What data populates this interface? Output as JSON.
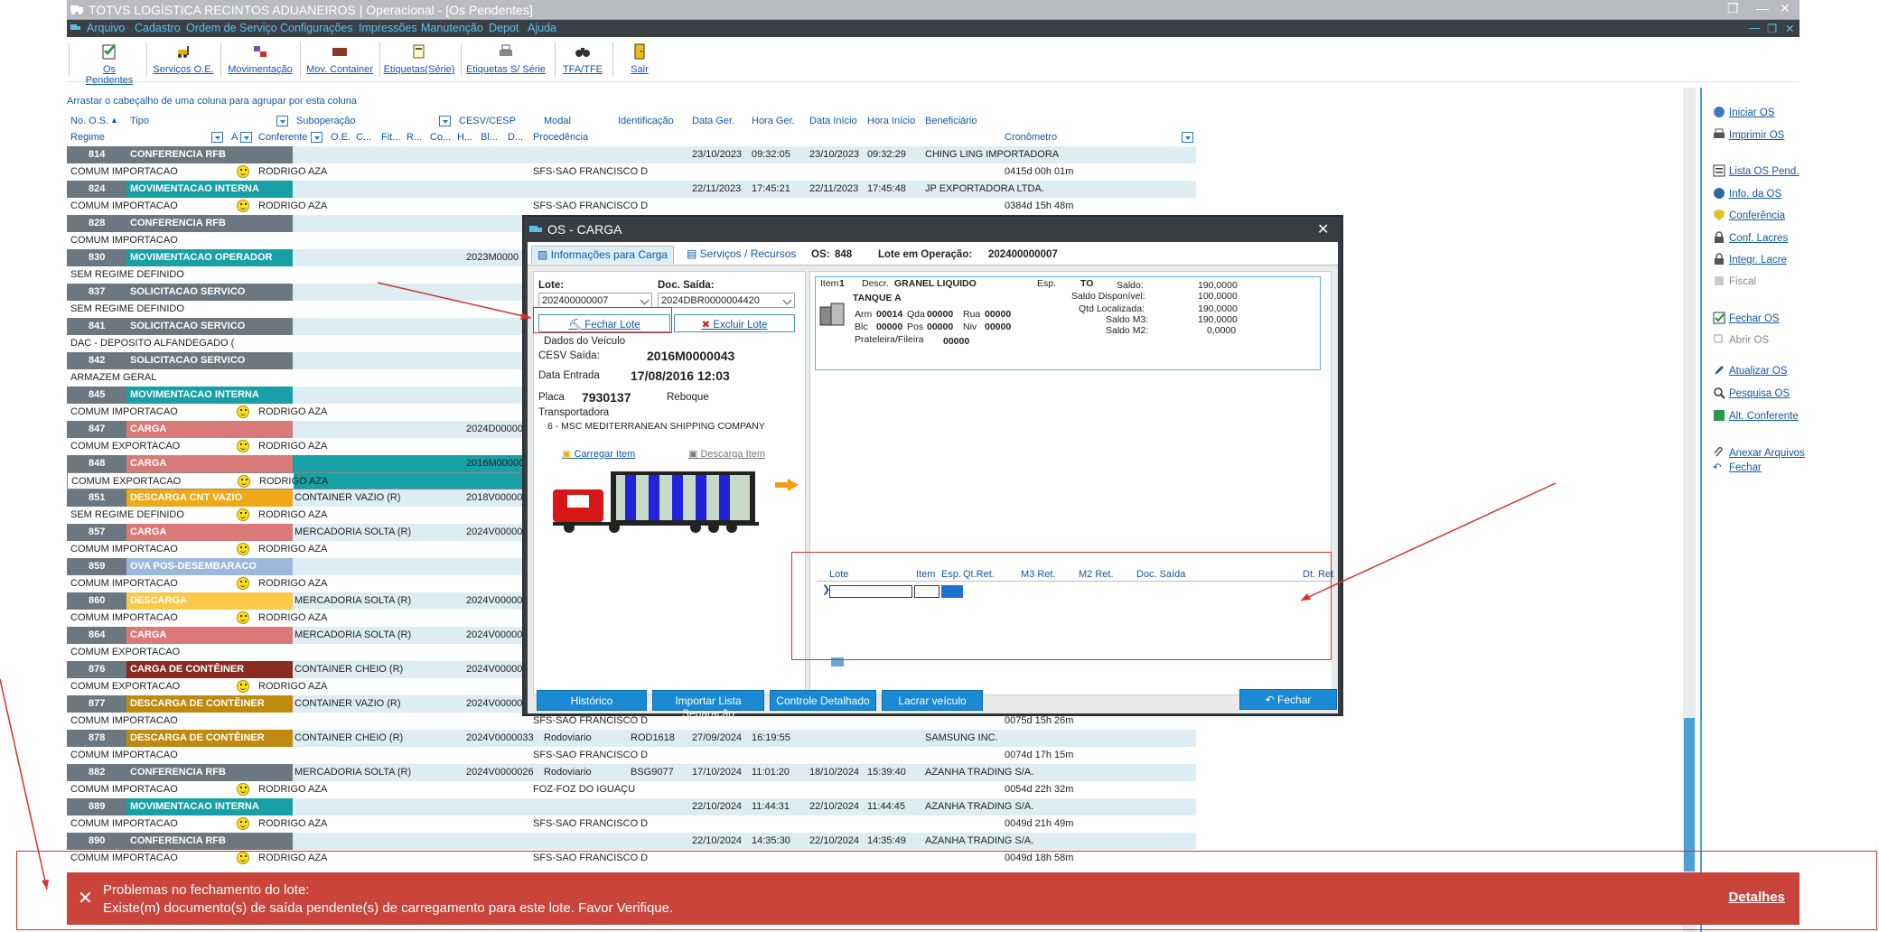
{
  "app": {
    "title": "TOTVS LOGÍSTICA RECINTOS ADUANEIROS | Operacional - [Os Pendentes]"
  },
  "menu": [
    "Arquivo",
    "Cadastro",
    "Ordem de Serviço",
    "Configurações",
    "Impressões",
    "Manutenção",
    "Depot",
    "Ajuda"
  ],
  "toolbar": [
    "Os Pendentes",
    "Serviços O.E.",
    "Movimentação",
    "Mov. Container",
    "Etiquetas(Série)",
    "Etiquetas S/ Série",
    "TFA/TFE",
    "Sair"
  ],
  "grid": {
    "group_hint": "Arrastar o cabeçalho de uma coluna para agrupar por esta coluna",
    "h1": [
      "No. O.S.",
      "Tipo",
      "Suboperação",
      "CESV/CESP",
      "Modal",
      "Identificação",
      "Data Ger.",
      "Hora Ger.",
      "Data Início",
      "Hora Início",
      "Beneficiário"
    ],
    "h2": [
      "Regime",
      "A",
      "Conferente",
      "O.E.",
      "C...",
      "Fit...",
      "R...",
      "Co...",
      "H...",
      "Bl...",
      "D...",
      "Procedência",
      "Cronômetro"
    ],
    "rows": [
      {
        "os": "814",
        "tipo": "CONFERENCIA RFB",
        "color": "#6b7881",
        "cesv": "",
        "dg": "23/10/2023",
        "hg": "09:32:05",
        "di": "23/10/2023",
        "hi": "09:32:29",
        "ben": "CHING LING IMPORTADORA",
        "regime": "COMUM IMPORTACAO",
        "conf": "RODRIGO AZA",
        "proc": "SFS-SAO FRANCISCO D",
        "crono": "0415d 00h 01m",
        "sub": ""
      },
      {
        "os": "824",
        "tipo": "MOVIMENTACAO INTERNA",
        "color": "#17a0a6",
        "cesv": "",
        "dg": "22/11/2023",
        "hg": "17:45:21",
        "di": "22/11/2023",
        "hi": "17:45:48",
        "ben": "JP EXPORTADORA LTDA.",
        "regime": "COMUM IMPORTACAO",
        "conf": "RODRIGO AZA",
        "proc": "SFS-SAO FRANCISCO D",
        "crono": "0384d 15h 48m",
        "sub": ""
      },
      {
        "os": "828",
        "tipo": "CONFERENCIA RFB",
        "color": "#6b7881",
        "cesv": "",
        "dg": "",
        "hg": "",
        "di": "",
        "hi": "",
        "ben": "",
        "regime": "COMUM IMPORTACAO",
        "conf": "",
        "proc": "",
        "crono": "",
        "sub": ""
      },
      {
        "os": "830",
        "tipo": "MOVIMENTACAO OPERADOR",
        "color": "#17a0a6",
        "cesv": "2023M0000",
        "dg": "",
        "hg": "",
        "di": "",
        "hi": "",
        "ben": "",
        "regime": "SEM REGIME DEFINIDO",
        "conf": "",
        "proc": "",
        "crono": "",
        "sub": ""
      },
      {
        "os": "837",
        "tipo": "SOLICITACAO SERVICO",
        "color": "#6b7881",
        "cesv": "",
        "dg": "",
        "hg": "",
        "di": "",
        "hi": "",
        "ben": "",
        "regime": "SEM REGIME DEFINIDO",
        "conf": "",
        "proc": "",
        "crono": "",
        "sub": ""
      },
      {
        "os": "841",
        "tipo": "SOLICITACAO SERVICO",
        "color": "#6b7881",
        "cesv": "",
        "dg": "",
        "hg": "",
        "di": "",
        "hi": "",
        "ben": "",
        "regime": "DAC - DEPOSITO ALFANDEGADO (",
        "conf": "",
        "proc": "",
        "crono": "",
        "sub": ""
      },
      {
        "os": "842",
        "tipo": "SOLICITACAO SERVICO",
        "color": "#6b7881",
        "cesv": "",
        "dg": "",
        "hg": "",
        "di": "",
        "hi": "",
        "ben": "",
        "regime": "ARMAZEM GERAL",
        "conf": "",
        "proc": "",
        "crono": "",
        "sub": ""
      },
      {
        "os": "845",
        "tipo": "MOVIMENTACAO INTERNA",
        "color": "#17a0a6",
        "cesv": "",
        "dg": "",
        "hg": "",
        "di": "",
        "hi": "",
        "ben": "",
        "regime": "COMUM IMPORTACAO",
        "conf": "RODRIGO AZA",
        "proc": "",
        "crono": "",
        "sub": ""
      },
      {
        "os": "847",
        "tipo": "CARGA",
        "color": "#d97a78",
        "cesv": "2024D00000",
        "dg": "",
        "hg": "",
        "di": "",
        "hi": "",
        "ben": "",
        "regime": "COMUM EXPORTACAO",
        "conf": "RODRIGO AZA",
        "proc": "",
        "crono": "",
        "sub": ""
      },
      {
        "os": "848",
        "tipo": "CARGA",
        "color": "#d97a78",
        "cesv": "2016M00000",
        "dg": "",
        "hg": "",
        "di": "",
        "hi": "",
        "ben": "",
        "regime": "COMUM EXPORTACAO",
        "conf": "RODRIGO AZA",
        "proc": "",
        "crono": "",
        "sub": "",
        "selected": true
      },
      {
        "os": "851",
        "tipo": "DESCARGA CNT VAZIO",
        "color": "#f0a818",
        "cesv": "2018V00000",
        "dg": "",
        "hg": "",
        "di": "",
        "hi": "",
        "ben": "",
        "regime": "SEM REGIME DEFINIDO",
        "conf": "RODRIGO AZA",
        "proc": "",
        "crono": "",
        "sub": "CONTAINER VAZIO (R)"
      },
      {
        "os": "857",
        "tipo": "CARGA",
        "color": "#d97a78",
        "cesv": "2024V00000",
        "dg": "",
        "hg": "",
        "di": "",
        "hi": "",
        "ben": "",
        "regime": "COMUM IMPORTACAO",
        "conf": "RODRIGO AZA",
        "proc": "",
        "crono": "",
        "sub": "MERCADORIA SOLTA (R)"
      },
      {
        "os": "859",
        "tipo": "OVA POS-DESEMBARACO",
        "color": "#9ab8dc",
        "cesv": "",
        "dg": "",
        "hg": "",
        "di": "",
        "hi": "",
        "ben": "",
        "regime": "COMUM IMPORTACAO",
        "conf": "RODRIGO AZA",
        "proc": "",
        "crono": "",
        "sub": ""
      },
      {
        "os": "860",
        "tipo": "DESCARGA",
        "color": "#fbc848",
        "cesv": "2024V00000",
        "dg": "",
        "hg": "",
        "di": "",
        "hi": "",
        "ben": "",
        "regime": "COMUM IMPORTACAO",
        "conf": "RODRIGO AZA",
        "proc": "",
        "crono": "",
        "sub": "MERCADORIA SOLTA (R)"
      },
      {
        "os": "864",
        "tipo": "CARGA",
        "color": "#d97a78",
        "cesv": "2024V00000",
        "dg": "",
        "hg": "",
        "di": "",
        "hi": "",
        "ben": "",
        "regime": "COMUM EXPORTACAO",
        "conf": "",
        "proc": "",
        "crono": "",
        "sub": "MERCADORIA SOLTA (R)"
      },
      {
        "os": "876",
        "tipo": "CARGA DE CONTÊINER",
        "color": "#8a2b22",
        "cesv": "2024V00000",
        "dg": "",
        "hg": "",
        "di": "",
        "hi": "",
        "ben": "",
        "regime": "COMUM EXPORTACAO",
        "conf": "RODRIGO AZA",
        "proc": "",
        "crono": "",
        "sub": "CONTAINER CHEIO (R)"
      },
      {
        "os": "877",
        "tipo": "DESCARGA DE CONTÊINER",
        "color": "#c08a10",
        "cesv": "2024V00000",
        "dg": "",
        "hg": "",
        "di": "",
        "hi": "",
        "ben": "",
        "regime": "COMUM IMPORTACAO",
        "conf": "",
        "proc": "SFS-SAO FRANCISCO D",
        "crono": "0075d 15h 26m",
        "sub": "CONTAINER VAZIO (R)"
      },
      {
        "os": "878",
        "tipo": "DESCARGA DE CONTÊINER",
        "color": "#c08a10",
        "cesv": "2024V0000033",
        "modal": "Rodoviario",
        "ident": "ROD1618",
        "dg": "27/09/2024",
        "hg": "16:19:55",
        "di": "",
        "hi": "",
        "ben": "SAMSUNG INC.",
        "regime": "COMUM IMPORTACAO",
        "conf": "",
        "proc": "SFS-SAO FRANCISCO D",
        "crono": "0074d 17h 15m",
        "sub": "CONTAINER CHEIO (R)"
      },
      {
        "os": "882",
        "tipo": "CONFERENCIA RFB",
        "color": "#6b7881",
        "cesv": "2024V0000026",
        "modal": "Rodoviario",
        "ident": "BSG9077",
        "dg": "17/10/2024",
        "hg": "11:01:20",
        "di": "18/10/2024",
        "hi": "15:39:40",
        "ben": "AZANHA TRADING S/A.",
        "regime": "COMUM IMPORTACAO",
        "conf": "RODRIGO AZA",
        "proc": "FOZ-FOZ DO IGUAÇU",
        "crono": "0054d 22h 32m",
        "sub": "MERCADORIA SOLTA (R)"
      },
      {
        "os": "889",
        "tipo": "MOVIMENTACAO INTERNA",
        "color": "#17a0a6",
        "cesv": "",
        "dg": "22/10/2024",
        "hg": "11:44:31",
        "di": "22/10/2024",
        "hi": "11:44:45",
        "ben": "AZANHA TRADING S/A.",
        "regime": "COMUM IMPORTACAO",
        "conf": "RODRIGO AZA",
        "proc": "SFS-SAO FRANCISCO D",
        "crono": "0049d 21h 49m",
        "sub": ""
      },
      {
        "os": "890",
        "tipo": "CONFERENCIA RFB",
        "color": "#6b7881",
        "cesv": "",
        "dg": "22/10/2024",
        "hg": "14:35:30",
        "di": "22/10/2024",
        "hi": "14:35:49",
        "ben": "AZANHA TRADING S/A.",
        "regime": "COMUM IMPORTACAO",
        "conf": "RODRIGO AZA",
        "proc": "SFS-SAO FRANCISCO D",
        "crono": "0049d 18h 58m",
        "sub": ""
      }
    ]
  },
  "right_panel": [
    "Iniciar OS",
    "Imprimir OS",
    "Lista OS Pend.",
    "Info. da OS",
    "Conferência",
    "Conf. Lacres",
    "Integr. Lacre",
    "Fiscal",
    "Fechar OS",
    "Abrir OS",
    "Atualizar OS",
    "Pesquisa OS",
    "Alt. Conferente",
    "Anexar Arquivos",
    "Fechar"
  ],
  "dialog": {
    "title": "OS - CARGA",
    "tabs": [
      "Informações para Carga",
      "Serviços / Recursos"
    ],
    "os_label": "OS:",
    "os_value": "848",
    "lote_op_label": "Lote em Operação:",
    "lote_op_value": "202400000007",
    "lote_label": "Lote:",
    "lote_value": "202400000007",
    "doc_label": "Doc. Saída:",
    "doc_value": "2024DBR0000004420",
    "fechar_lote": "Fechar Lote",
    "excluir_lote": "Excluir Lote",
    "veiculo_label": "Dados do Veículo",
    "cesv_label": "CESV Saída:",
    "cesv_value": "2016M0000043",
    "entrada_label": "Data Entrada",
    "entrada_value": "17/08/2016 12:03",
    "placa_label": "Placa",
    "placa_value": "7930137",
    "reboque_label": "Reboque",
    "transp_label": "Transportadora",
    "transp_value": "6 - MSC  MEDITERRANEAN SHIPPING COMPANY",
    "carregar": "Carregar Item",
    "descarga": "Descarga Item",
    "item_label": "Item",
    "item_value": "1",
    "descr_label": "Descr.",
    "descr_value": "GRANEL LIQUIDO",
    "esp_label": "Esp.",
    "esp_value": "TO",
    "tanque": "TANQUE A",
    "arm_label": "Arm",
    "arm": "00014",
    "qda_label": "Qda",
    "qda": "00000",
    "rua_label": "Rua",
    "rua": "00000",
    "blc_label": "Blc",
    "blc": "00000",
    "pos_label": "Pos",
    "pos": "00000",
    "niv_label": "Niv",
    "niv": "00000",
    "prat_label": "Prateleira/Fileira",
    "prat": "00000",
    "saldo_label": "Saldo:",
    "saldo": "190,0000",
    "saldo_disp_label": "Saldo Disponível:",
    "saldo_disp": "100,0000",
    "qtd_loc_label": "Qtd Localizada:",
    "qtd_loc": "190,0000",
    "m3_label": "Saldo M3:",
    "m3": "190,0000",
    "m2_label": "Saldo M2:",
    "m2": "0,0000",
    "grid_cols": [
      "Lote",
      "Item",
      "Esp.",
      "Qt.Ret.",
      "M3 Ret.",
      "M2 Ret.",
      "Doc. Saída",
      "Dt. Ret"
    ],
    "buttons": [
      "Histórico",
      "Importar Lista Separação",
      "Controle Detalhado",
      "Lacrar veículo"
    ],
    "close_btn": "Fechar"
  },
  "toast": {
    "line1": "Problemas no fechamento do lote:",
    "line2": "Existe(m) documento(s) de saída pendente(s) de carregamento para este lote. Favor Verifique.",
    "details": "Detalhes"
  }
}
